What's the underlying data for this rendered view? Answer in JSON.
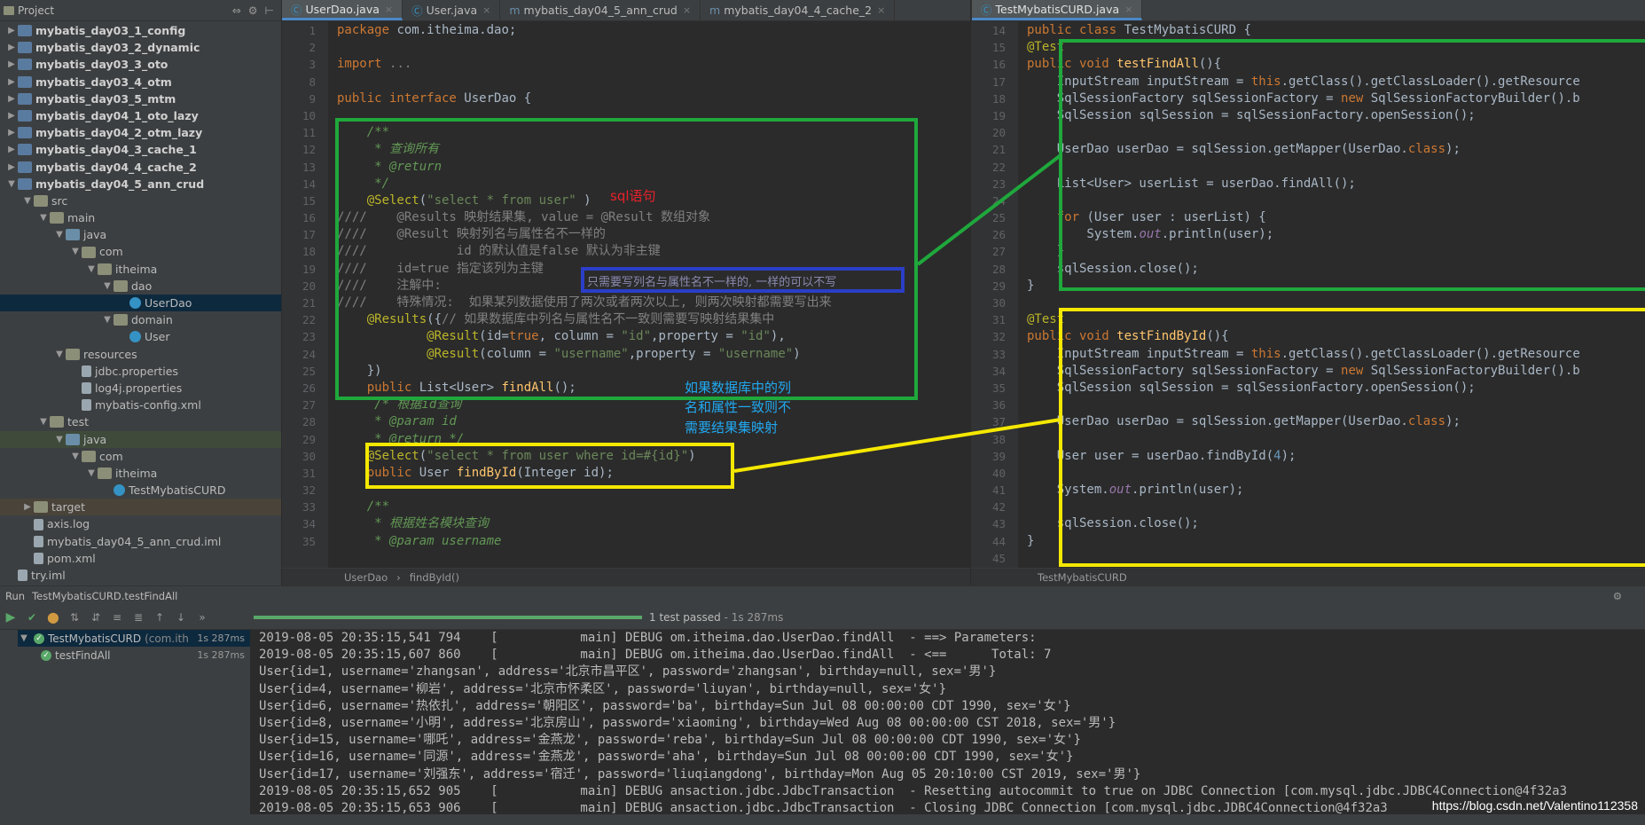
{
  "project": {
    "header": "Project",
    "items": [
      {
        "label": "mybatis_day03_1_config",
        "level": 1,
        "arrow": "▶",
        "icon": "mod",
        "bold": true
      },
      {
        "label": "mybatis_day03_2_dynamic",
        "level": 1,
        "arrow": "▶",
        "icon": "mod",
        "bold": true
      },
      {
        "label": "mybatis_day03_3_oto",
        "level": 1,
        "arrow": "▶",
        "icon": "mod",
        "bold": true
      },
      {
        "label": "mybatis_day03_4_otm",
        "level": 1,
        "arrow": "▶",
        "icon": "mod",
        "bold": true
      },
      {
        "label": "mybatis_day03_5_mtm",
        "level": 1,
        "arrow": "▶",
        "icon": "mod",
        "bold": true
      },
      {
        "label": "mybatis_day04_1_oto_lazy",
        "level": 1,
        "arrow": "▶",
        "icon": "mod",
        "bold": true
      },
      {
        "label": "mybatis_day04_2_otm_lazy",
        "level": 1,
        "arrow": "▶",
        "icon": "mod",
        "bold": true
      },
      {
        "label": "mybatis_day04_3_cache_1",
        "level": 1,
        "arrow": "▶",
        "icon": "mod",
        "bold": true
      },
      {
        "label": "mybatis_day04_4_cache_2",
        "level": 1,
        "arrow": "▶",
        "icon": "mod",
        "bold": true
      },
      {
        "label": "mybatis_day04_5_ann_crud",
        "level": 1,
        "arrow": "▼",
        "icon": "mod",
        "bold": true
      },
      {
        "label": "src",
        "level": 2,
        "arrow": "▼",
        "icon": "folder"
      },
      {
        "label": "main",
        "level": 3,
        "arrow": "▼",
        "icon": "folder"
      },
      {
        "label": "java",
        "level": 4,
        "arrow": "▼",
        "icon": "src"
      },
      {
        "label": "com",
        "level": 5,
        "arrow": "▼",
        "icon": "folder"
      },
      {
        "label": "itheima",
        "level": 6,
        "arrow": "▼",
        "icon": "folder"
      },
      {
        "label": "dao",
        "level": 7,
        "arrow": "▼",
        "icon": "folder"
      },
      {
        "label": "UserDao",
        "level": 8,
        "arrow": "",
        "icon": "cls",
        "sel": true
      },
      {
        "label": "domain",
        "level": 7,
        "arrow": "▼",
        "icon": "folder"
      },
      {
        "label": "User",
        "level": 8,
        "arrow": "",
        "icon": "cls"
      },
      {
        "label": "resources",
        "level": 4,
        "arrow": "▼",
        "icon": "folder"
      },
      {
        "label": "jdbc.properties",
        "level": 5,
        "arrow": "",
        "icon": "file"
      },
      {
        "label": "log4j.properties",
        "level": 5,
        "arrow": "",
        "icon": "file"
      },
      {
        "label": "mybatis-config.xml",
        "level": 5,
        "arrow": "",
        "icon": "file"
      },
      {
        "label": "test",
        "level": 3,
        "arrow": "▼",
        "icon": "folder"
      },
      {
        "label": "java",
        "level": 4,
        "arrow": "▼",
        "icon": "src",
        "grn": true
      },
      {
        "label": "com",
        "level": 5,
        "arrow": "▼",
        "icon": "folder"
      },
      {
        "label": "itheima",
        "level": 6,
        "arrow": "▼",
        "icon": "folder"
      },
      {
        "label": "TestMybatisCURD",
        "level": 7,
        "arrow": "",
        "icon": "cls"
      },
      {
        "label": "target",
        "level": 2,
        "arrow": "▶",
        "icon": "folder",
        "exc": true
      },
      {
        "label": "axis.log",
        "level": 2,
        "arrow": "",
        "icon": "file"
      },
      {
        "label": "mybatis_day04_5_ann_crud.iml",
        "level": 2,
        "arrow": "",
        "icon": "file"
      },
      {
        "label": "pom.xml",
        "level": 2,
        "arrow": "",
        "icon": "file"
      },
      {
        "label": "try.iml",
        "level": 1,
        "arrow": "",
        "icon": "file"
      }
    ]
  },
  "left_editor": {
    "tabs": [
      {
        "label": "UserDao.java",
        "active": true
      },
      {
        "label": "User.java"
      },
      {
        "label": "mybatis_day04_5_ann_crud"
      },
      {
        "label": "mybatis_day04_4_cache_2"
      }
    ],
    "line_numbers": [
      "1",
      "2",
      "3",
      "8",
      "9",
      "10",
      "11",
      "12",
      "13",
      "14",
      "15",
      "16",
      "17",
      "18",
      "19",
      "20",
      "21",
      "22",
      "23",
      "24",
      "25",
      "26",
      "27",
      "28",
      "29",
      "30",
      "31",
      "32",
      "33",
      "34",
      "35"
    ],
    "lines": [
      [
        [
          "kw",
          "package "
        ],
        [
          "",
          "com.itheima.dao;"
        ]
      ],
      [
        [
          "",
          ""
        ]
      ],
      [
        [
          "kw",
          "import "
        ],
        [
          "cm",
          "..."
        ]
      ],
      [
        [
          "",
          ""
        ]
      ],
      [
        [
          "kw",
          "public interface "
        ],
        [
          "",
          "UserDao {"
        ]
      ],
      [
        [
          "",
          ""
        ]
      ],
      [
        [
          "dc",
          "    /**"
        ]
      ],
      [
        [
          "dc",
          "     * 查询所有"
        ]
      ],
      [
        [
          "dc",
          "     * @return"
        ]
      ],
      [
        [
          "dc",
          "     */"
        ]
      ],
      [
        [
          "an",
          "    @Select"
        ],
        [
          "",
          "("
        ],
        [
          "st",
          "\"select * from user\""
        ],
        [
          "",
          " )"
        ]
      ],
      [
        [
          "cm",
          "////    @Results 映射结果集, value = @Result 数组对象"
        ]
      ],
      [
        [
          "cm",
          "////    @Result 映射列名与属性名不一样的"
        ]
      ],
      [
        [
          "cm",
          "////            id 的默认值是false 默认为非主键"
        ]
      ],
      [
        [
          "cm",
          "////    id=true 指定该列为主键"
        ]
      ],
      [
        [
          "cm",
          "////    注解中:"
        ]
      ],
      [
        [
          "cm",
          "////    特殊情况:  如果某列数据使用了两次或者两次以上, 则两次映射都需要写出来"
        ]
      ],
      [
        [
          "an",
          "    @Results"
        ],
        [
          "",
          "({"
        ],
        [
          "cm",
          "// 如果数据库中列名与属性名不一致则需要写映射结果集中"
        ]
      ],
      [
        [
          "an",
          "            @Result"
        ],
        [
          "",
          "(id="
        ],
        [
          "kw",
          "true"
        ],
        [
          "",
          ", column = "
        ],
        [
          "st",
          "\"id\""
        ],
        [
          "",
          ",property = "
        ],
        [
          "st",
          "\"id\""
        ],
        [
          "",
          "),"
        ]
      ],
      [
        [
          "an",
          "            @Result"
        ],
        [
          "",
          "(column = "
        ],
        [
          "st",
          "\"username\""
        ],
        [
          "",
          ",property = "
        ],
        [
          "st",
          "\"username\""
        ],
        [
          "",
          ")"
        ]
      ],
      [
        [
          "",
          "    })"
        ]
      ],
      [
        [
          "kw",
          "    public "
        ],
        [
          "",
          "List<User> "
        ],
        [
          "fn",
          "findAll"
        ],
        [
          "",
          "();"
        ]
      ],
      [
        [
          "dc",
          "     /* 根据id查询"
        ]
      ],
      [
        [
          "dc",
          "     * @param id"
        ]
      ],
      [
        [
          "dc",
          "     * @return */"
        ]
      ],
      [
        [
          "an",
          "    @Select"
        ],
        [
          "",
          "("
        ],
        [
          "st",
          "\"select * from user where id=#{id}\""
        ],
        [
          "",
          ")"
        ]
      ],
      [
        [
          "kw",
          "    public "
        ],
        [
          "",
          "User "
        ],
        [
          "fn",
          "findById"
        ],
        [
          "",
          "(Integer id);"
        ]
      ],
      [
        [
          "",
          ""
        ]
      ],
      [
        [
          "dc",
          "    /**"
        ]
      ],
      [
        [
          "dc",
          "     * 根据姓名模块查询"
        ]
      ],
      [
        [
          "dc",
          "     * @param username"
        ]
      ]
    ],
    "breadcrumb": [
      "UserDao",
      "findById()"
    ]
  },
  "right_editor": {
    "tabs": [
      {
        "label": "TestMybatisCURD.java",
        "active": true
      }
    ],
    "line_numbers": [
      "14",
      "15",
      "16",
      "17",
      "18",
      "19",
      "20",
      "21",
      "22",
      "23",
      "24",
      "25",
      "26",
      "27",
      "28",
      "29",
      "30",
      "31",
      "32",
      "33",
      "34",
      "35",
      "36",
      "37",
      "38",
      "39",
      "40",
      "41",
      "42",
      "43",
      "44",
      "45"
    ],
    "lines": [
      [
        [
          "kw",
          "public class "
        ],
        [
          "",
          "TestMybatisCURD {"
        ]
      ],
      [
        [
          "an",
          "@Test"
        ]
      ],
      [
        [
          "kw",
          "public void "
        ],
        [
          "fn",
          "testFindAll"
        ],
        [
          "",
          "(){"
        ]
      ],
      [
        [
          "",
          "    InputStream inputStream = "
        ],
        [
          "kw",
          "this"
        ],
        [
          "",
          ".getClass().getClassLoader().getResource"
        ]
      ],
      [
        [
          "",
          "    SqlSessionFactory sqlSessionFactory = "
        ],
        [
          "kw",
          "new "
        ],
        [
          "",
          "SqlSessionFactoryBuilder().b"
        ]
      ],
      [
        [
          "",
          "    SqlSession sqlSession = sqlSessionFactory.openSession();"
        ]
      ],
      [
        [
          "",
          ""
        ]
      ],
      [
        [
          "",
          "    UserDao userDao = sqlSession.getMapper(UserDao."
        ],
        [
          "kw",
          "class"
        ],
        [
          "",
          ");"
        ]
      ],
      [
        [
          "",
          ""
        ]
      ],
      [
        [
          "",
          "    List<User> userList = userDao.findAll();"
        ]
      ],
      [
        [
          "",
          ""
        ]
      ],
      [
        [
          "kw",
          "    for "
        ],
        [
          "",
          "(User user : userList) {"
        ]
      ],
      [
        [
          "",
          "        System."
        ],
        [
          "fld",
          "out"
        ],
        [
          "",
          ".println(user);"
        ]
      ],
      [
        [
          "",
          "    }"
        ]
      ],
      [
        [
          "",
          "    sqlSession.close();"
        ]
      ],
      [
        [
          "",
          "}"
        ]
      ],
      [
        [
          "",
          ""
        ]
      ],
      [
        [
          "an",
          "@Test"
        ]
      ],
      [
        [
          "kw",
          "public void "
        ],
        [
          "fn",
          "testFindById"
        ],
        [
          "",
          "(){"
        ]
      ],
      [
        [
          "",
          "    InputStream inputStream = "
        ],
        [
          "kw",
          "this"
        ],
        [
          "",
          ".getClass().getClassLoader().getResource"
        ]
      ],
      [
        [
          "",
          "    SqlSessionFactory sqlSessionFactory = "
        ],
        [
          "kw",
          "new "
        ],
        [
          "",
          "SqlSessionFactoryBuilder().b"
        ]
      ],
      [
        [
          "",
          "    SqlSession sqlSession = sqlSessionFactory.openSession();"
        ]
      ],
      [
        [
          "",
          ""
        ]
      ],
      [
        [
          "",
          "    UserDao userDao = sqlSession.getMapper(UserDao."
        ],
        [
          "kw",
          "class"
        ],
        [
          "",
          ");"
        ]
      ],
      [
        [
          "",
          ""
        ]
      ],
      [
        [
          "",
          "    User user = userDao.findById("
        ],
        [
          "nm",
          "4"
        ],
        [
          "",
          ");"
        ]
      ],
      [
        [
          "",
          ""
        ]
      ],
      [
        [
          "",
          "    System."
        ],
        [
          "fld",
          "out"
        ],
        [
          "",
          ".println(user);"
        ]
      ],
      [
        [
          "",
          ""
        ]
      ],
      [
        [
          "",
          "    sqlSession.close();"
        ]
      ],
      [
        [
          "",
          "}"
        ]
      ],
      [
        [
          "",
          ""
        ]
      ]
    ],
    "breadcrumb": [
      "TestMybatisCURD"
    ]
  },
  "run": {
    "tab_label": "TestMybatisCURD.testFindAll",
    "run_prefix": "Run",
    "status": "1 test passed",
    "status_time": "- 1s 287ms",
    "tree": [
      {
        "label": "TestMybatisCURD",
        "sub": "(com.ith",
        "time": "1s 287ms"
      },
      {
        "label": "testFindAll",
        "time": "1s 287ms"
      }
    ],
    "console": [
      "2019-08-05 20:35:15,541 794    [           main] DEBUG om.itheima.dao.UserDao.findAll  - ==> Parameters: ",
      "2019-08-05 20:35:15,607 860    [           main] DEBUG om.itheima.dao.UserDao.findAll  - <==      Total: 7",
      "User{id=1, username='zhangsan', address='北京市昌平区', password='zhangsan', birthday=null, sex='男'}",
      "User{id=4, username='柳岩', address='北京市怀柔区', password='liuyan', birthday=null, sex='女'}",
      "User{id=6, username='热依扎', address='朝阳区', password='ba', birthday=Sun Jul 08 00:00:00 CDT 1990, sex='女'}",
      "User{id=8, username='小明', address='北京房山', password='xiaoming', birthday=Wed Aug 08 00:00:00 CST 2018, sex='男'}",
      "User{id=15, username='哪吒', address='金燕龙', password='reba', birthday=Sun Jul 08 00:00:00 CDT 1990, sex='女'}",
      "User{id=16, username='同源', address='金燕龙', password='aha', birthday=Sun Jul 08 00:00:00 CDT 1990, sex='女'}",
      "User{id=17, username='刘强东', address='宿迁', password='liuqiangdong', birthday=Mon Aug 05 20:10:00 CST 2019, sex='男'}",
      "2019-08-05 20:35:15,652 905    [           main] DEBUG ansaction.jdbc.JdbcTransaction  - Resetting autocommit to true on JDBC Connection [com.mysql.jdbc.JDBC4Connection@4f32a3",
      "2019-08-05 20:35:15,653 906    [           main] DEBUG ansaction.jdbc.JdbcTransaction  - Closing JDBC Connection [com.mysql.jdbc.JDBC4Connection@4f32a3"
    ]
  },
  "annotations": {
    "sql_note": "sql语句",
    "blue_note": "只需要写列名与属性名不一样的, 一样的可以不写",
    "consistent_note": [
      "如果数据库中的列",
      "名和属性一致则不",
      "需要结果集映射"
    ],
    "colors": {
      "green": "#1fa83c",
      "yellow": "#f5e800",
      "blue": "#2b3ec8",
      "red": "#e8212b",
      "cyan": "#21a8f0"
    }
  },
  "watermark": "https://blog.csdn.net/Valentino112358"
}
